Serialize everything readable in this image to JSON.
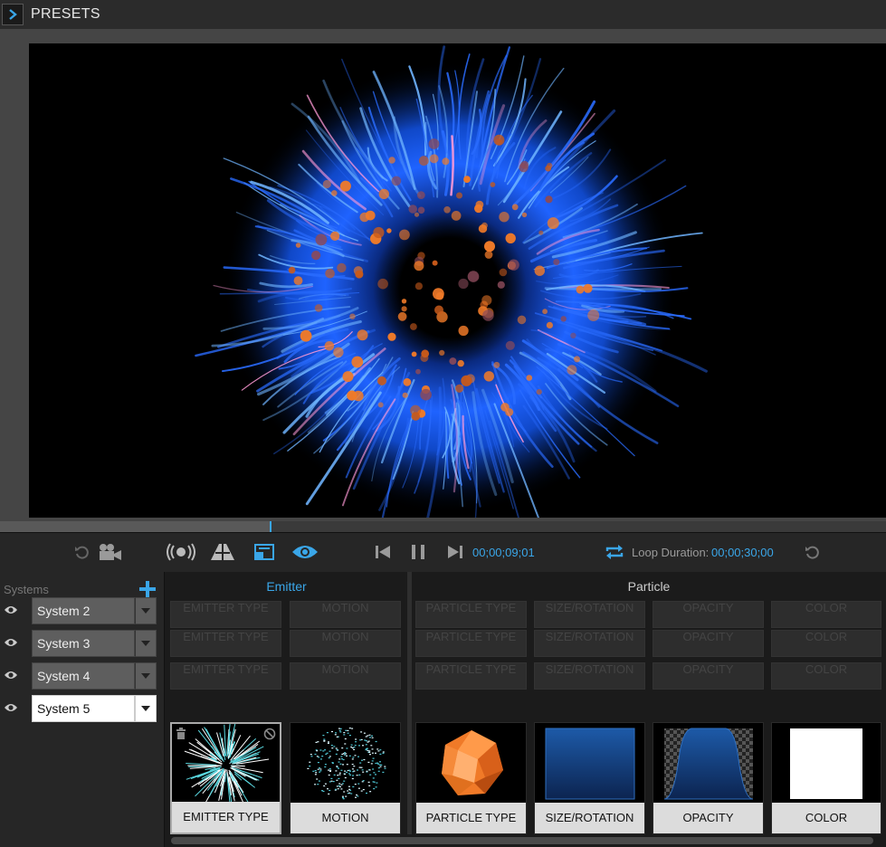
{
  "header": {
    "title": "PRESETS"
  },
  "timeline": {
    "progress_fraction": 0.305
  },
  "controls": {
    "current_time": "00;00;09;01",
    "loop_label": "Loop Duration:",
    "loop_value": "00;00;30;00"
  },
  "systems": {
    "title": "Systems",
    "items": [
      {
        "label": "System 2"
      },
      {
        "label": "System 3"
      },
      {
        "label": "System 4"
      },
      {
        "label": "System 5"
      }
    ]
  },
  "sections": {
    "emitter": "Emitter",
    "particle": "Particle"
  },
  "ghost_labels": [
    "EMITTER TYPE",
    "MOTION",
    "PARTICLE TYPE",
    "SIZE/ROTATION",
    "OPACITY",
    "COLOR"
  ],
  "cards": [
    "EMITTER TYPE",
    "MOTION",
    "PARTICLE TYPE",
    "SIZE/ROTATION",
    "OPACITY",
    "COLOR"
  ],
  "colors": {
    "accent": "#3aa6e8",
    "particle_orange": "#f07a28",
    "glow_blue": "#1f63ff"
  }
}
